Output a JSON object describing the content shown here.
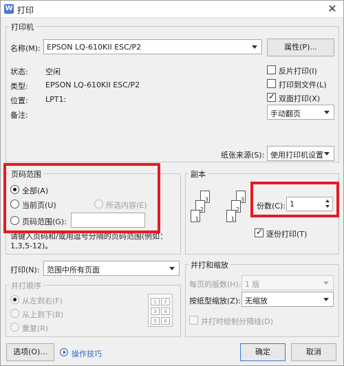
{
  "window": {
    "title": "打印",
    "app_icon_letter": "W",
    "close_glyph": "✕"
  },
  "printer": {
    "group_title": "打印机",
    "name_label": "名称(M):",
    "name_value": "EPSON LQ-610KII ESC/P2",
    "properties_button": "属性(P)...",
    "status_label": "状态:",
    "status_value": "空闲",
    "type_label": "类型:",
    "type_value": "EPSON LQ-610KII ESC/P2",
    "location_label": "位置:",
    "location_value": "LPT1:",
    "note_label": "备注:",
    "reverse_print": "反片打印(I)",
    "print_to_file": "打印到文件(L)",
    "duplex": "双面打印(X)",
    "duplex_mode": "手动翻页",
    "paper_source_label": "纸张来源(S):",
    "paper_source_value": "使用打印机设置"
  },
  "range": {
    "group_title": "页码范围",
    "all": "全部(A)",
    "current": "当前页(U)",
    "selection": "所选内容(E)",
    "pages": "页码范围(G):",
    "pages_value": "",
    "hint": "请键入页码和/或用逗号分隔的页码范围(例如：1,3,5-12)。"
  },
  "copies": {
    "group_title": "副本",
    "count_label": "份数(C):",
    "count_value": "1",
    "collate": "逐份打印(T)",
    "sheet_numbers": [
      "1",
      "2",
      "3",
      "1",
      "2",
      "3"
    ]
  },
  "print_what": {
    "label": "打印(N):",
    "value": "范围中所有页面",
    "order_title": "并打顺序",
    "left_to_right": "从左到右(F)",
    "top_to_bottom": "从上到下(B)",
    "repeat": "重复(R)",
    "grid_numbers": [
      "1",
      "2",
      "3",
      "4",
      "5",
      "6"
    ]
  },
  "zoom": {
    "group_title": "并打和缩放",
    "per_page_label": "每页的版数(H):",
    "per_page_value": "1 版",
    "scale_label": "按纸型缩放(Z):",
    "scale_value": "无缩放",
    "draw_borders": "并打时绘制分隔线(D)"
  },
  "footer": {
    "options_button": "选项(O)...",
    "tips_link": "操作技巧",
    "ok_button": "确定",
    "cancel_button": "取消"
  },
  "colors": {
    "highlight": "#e41c23",
    "link": "#2b6cc4",
    "focus": "#2f7bd8"
  }
}
